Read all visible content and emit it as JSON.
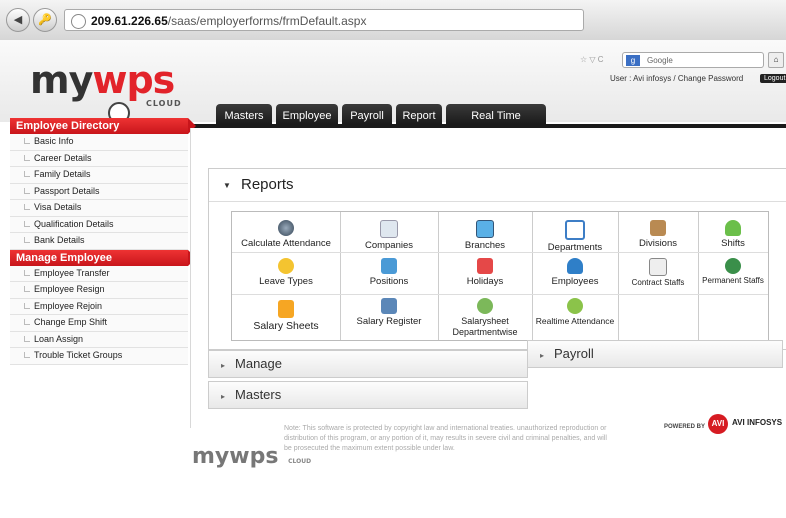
{
  "browser": {
    "url_host": "209.61.226.65",
    "url_path": "/saas/employerforms/frmDefault.aspx",
    "search_placeholder": "Google",
    "search_engine_icon": "g-icon"
  },
  "header": {
    "user_line": "User : Avi infosys  /  Change Password",
    "logout_label": "Logout"
  },
  "logo": {
    "my": "my",
    "wps": "wps",
    "cloud": "CLOUD"
  },
  "colors": {
    "brand_red": "#c8151b",
    "tab_dark": "#1b1b1b"
  },
  "tabs": [
    "Masters",
    "Employee",
    "Payroll",
    "Report",
    "Real Time Attendance"
  ],
  "sidebar": {
    "sections": [
      {
        "title": "Employee Directory",
        "items": [
          "Basic Info",
          "Career Details",
          "Family Details",
          "Passport Details",
          "Visa Details",
          "Qualification Details",
          "Bank Details"
        ]
      },
      {
        "title": "Manage Employee",
        "items": [
          "Employee Transfer",
          "Employee Resign",
          "Employee Rejoin",
          "Change Emp Shift",
          "Loan Assign",
          "Trouble Ticket Groups"
        ]
      }
    ]
  },
  "reports": {
    "title": "Reports",
    "items": [
      "Calculate Attendance",
      "Companies",
      "Branches",
      "Departments",
      "Divisions",
      "Shifts",
      "Leave Types",
      "Positions",
      "Holidays",
      "Employees",
      "Contract Staffs",
      "Permanent Staffs",
      "Salary Sheets",
      "Salary Register",
      "Salarysheet Departmentwise",
      "Realtime Attendance"
    ]
  },
  "accordions": {
    "manage": "Manage",
    "masters": "Masters",
    "payroll": "Payroll"
  },
  "footer": {
    "logo_my": "my",
    "logo_wps": "wps",
    "logo_cloud": "CLOUD",
    "note": "Note: This software is protected by copyright law and international treaties. unauthorized reproduction or distribution of this program, or any portion of it, may results in severe civil and criminal penalties, and will be prosecuted the maximum extent possible under law.",
    "powered_by": "POWERED BY",
    "company": "AVI INFOSYS"
  }
}
